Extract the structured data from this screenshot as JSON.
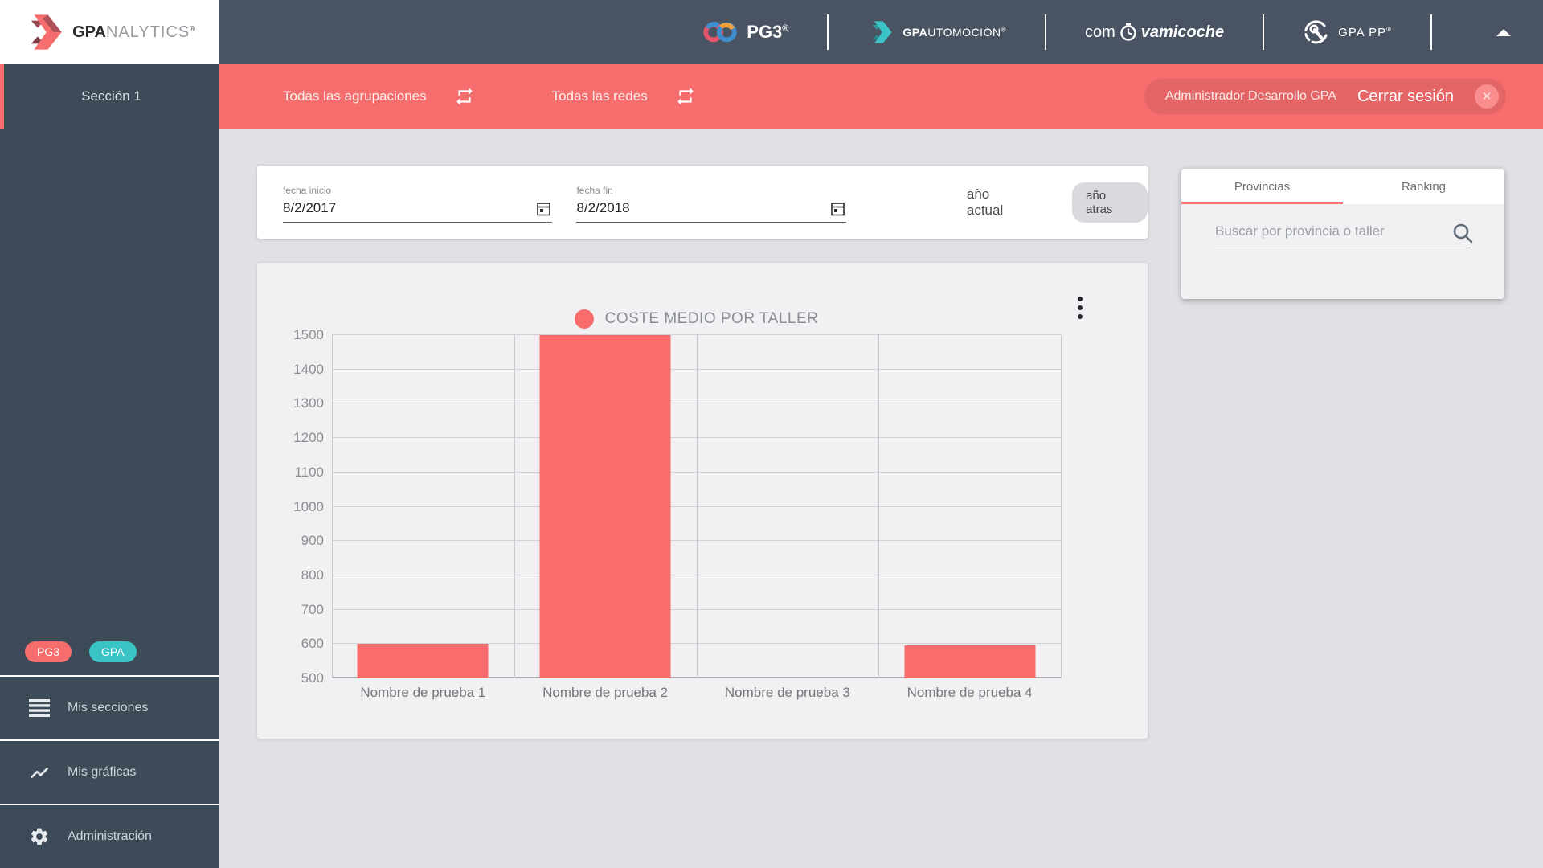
{
  "header": {
    "brand": {
      "bold": "GPA",
      "light": "NALYTICS",
      "reg": "®"
    },
    "logos": {
      "pg3": {
        "label": "PG3",
        "reg": "®"
      },
      "gpautomocion": {
        "bold": "GPA",
        "rest": "UTOMOCIÓN",
        "reg": "®"
      },
      "comprovamicoche": {
        "pre": "com",
        "post": "vamicoche"
      },
      "gpaapp": {
        "label": "GPA PP",
        "reg": "®"
      }
    }
  },
  "sidebar": {
    "section_label": "Sección 1",
    "badges": [
      {
        "label": "PG3",
        "color": "#f66d6d"
      },
      {
        "label": "GPA",
        "color": "#3cc3c6"
      }
    ],
    "items": [
      {
        "label": "Mis secciones",
        "icon": "list-icon"
      },
      {
        "label": "Mis gráficas",
        "icon": "trending-icon"
      },
      {
        "label": "Administración",
        "icon": "gear-icon"
      }
    ]
  },
  "toolbar": {
    "agrupaciones_label": "Todas las agrupaciones",
    "redes_label": "Todas las redes",
    "user_label": "Administrador Desarrollo GPA",
    "logout_label": "Cerrar sesión"
  },
  "filters": {
    "fecha_inicio": {
      "label": "fecha inicio",
      "value": "8/2/2017"
    },
    "fecha_fin": {
      "label": "fecha fin",
      "value": "8/2/2018"
    },
    "anio_actual_label": "año actual",
    "anio_atras_label": "año atras"
  },
  "panel": {
    "tabs": [
      {
        "label": "Provincias",
        "active": true
      },
      {
        "label": "Ranking",
        "active": false
      }
    ],
    "search_placeholder": "Buscar por provincia o taller"
  },
  "chart_data": {
    "type": "bar",
    "title": "COSTE MEDIO POR TALLER",
    "categories": [
      "Nombre de prueba 1",
      "Nombre de prueba 2",
      "Nombre de prueba 3",
      "Nombre de prueba 4"
    ],
    "values": [
      600,
      1550,
      null,
      597
    ],
    "ylim": [
      500,
      1500
    ],
    "yticks": [
      500,
      600,
      700,
      800,
      900,
      1000,
      1100,
      1200,
      1300,
      1400,
      1500
    ],
    "xlabel": "",
    "ylabel": "",
    "bar_color": "#f86c6c",
    "grid": true,
    "legend_position": "top",
    "notes": "Bar 2 is clipped at the plot top (value exceeds axis max 1500); bar 3 shows no bar (at or below axis min 500)."
  },
  "colors": {
    "accent_red": "#f66d6d",
    "accent_teal": "#3cc3c6",
    "header_slate": "#4a5362",
    "sidebar_slate": "#3d4a57",
    "page_bg": "#e1e1e5",
    "card_bg": "#f1f1f3"
  }
}
